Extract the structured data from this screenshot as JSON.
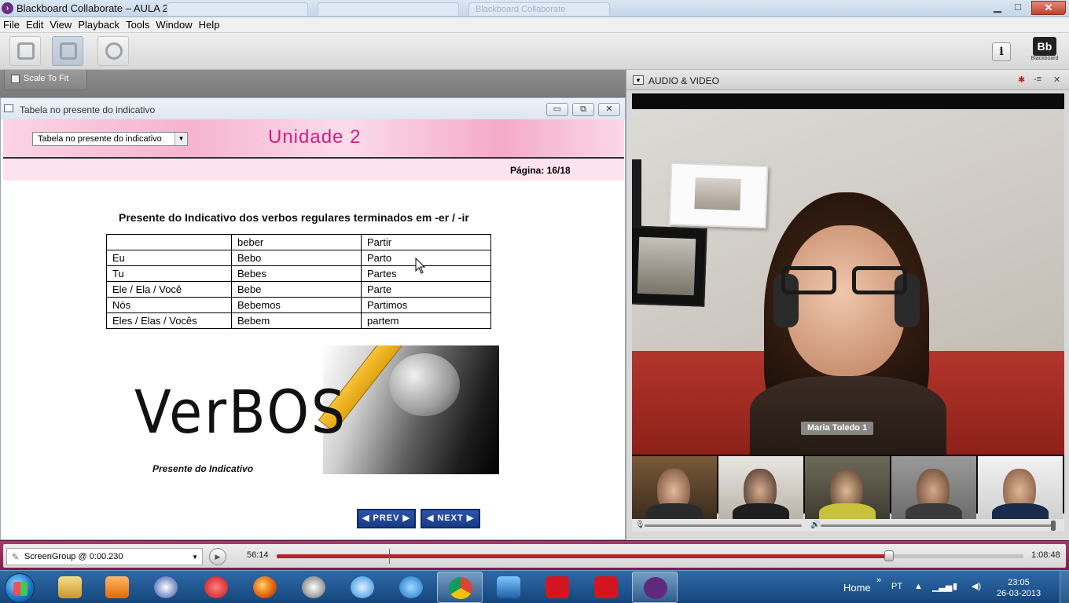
{
  "window": {
    "title": "Blackboard Collaborate – AULA 2",
    "ghost_tabs": [
      "",
      "",
      "Blackboard Collaborate"
    ],
    "controls": {
      "minimize": "▁",
      "maximize": "□",
      "close": "✕"
    }
  },
  "menu": [
    "File",
    "Edit",
    "View",
    "Playback",
    "Tools",
    "Window",
    "Help"
  ],
  "toolbar": {
    "info_label": "i",
    "logo_text": "Bb",
    "logo_caption": "Blackboard"
  },
  "content_bar": {
    "scale_to_fit": "Scale To Fit"
  },
  "content_window": {
    "title": "Tabela no presente do indicativo",
    "controls": {
      "minimize": "▭",
      "restore": "⧉",
      "close": "✕"
    },
    "dropdown_value": "Tabela no presente do indicativo",
    "unit_title": "Unidade 2",
    "page_indicator": "Página: 16/18",
    "heading": "Presente do Indicativo dos verbos regulares terminados em -er / -ir",
    "table": {
      "header": [
        "",
        "beber",
        "Partir"
      ],
      "rows": [
        [
          "Eu",
          "Bebo",
          "Parto"
        ],
        [
          "Tu",
          "Bebes",
          "Partes"
        ],
        [
          "Ele / Ela / Você",
          "Bebe",
          "Parte"
        ],
        [
          "Nós",
          "Bebemos",
          "Partimos"
        ],
        [
          "Eles / Elas / Vocês",
          "Bebem",
          "partem"
        ]
      ]
    },
    "image": {
      "word": "VerBOS",
      "subtitle": "Presente do Indicativo"
    },
    "nav": {
      "prev": "PREV",
      "next": "NEXT"
    }
  },
  "audio_video": {
    "title": "AUDIO & VIDEO",
    "speaker_name": "Maria Toledo 1",
    "thumbnails": 5
  },
  "playback": {
    "recording_selector": "ScreenGroup @ 0:00.230",
    "current_time": "56:14",
    "total_time": "1:08:48",
    "progress": 0.82,
    "marker": 0.15
  },
  "taskbar": {
    "apps": [
      "explorer",
      "media-player",
      "messenger",
      "pin-app",
      "firefox",
      "clock-app",
      "safari",
      "internet-explorer",
      "chrome",
      "remote-desktop",
      "coca-cola-1",
      "coca-cola-2",
      "collaborate"
    ],
    "home_label": "Home",
    "language": "PT",
    "time": "23:05",
    "date": "26-03-2013"
  },
  "colors": {
    "accent": "#d21f7d",
    "playbar": "#a73a6a",
    "progress": "#b3262c",
    "taskbar": "#1e5590"
  }
}
